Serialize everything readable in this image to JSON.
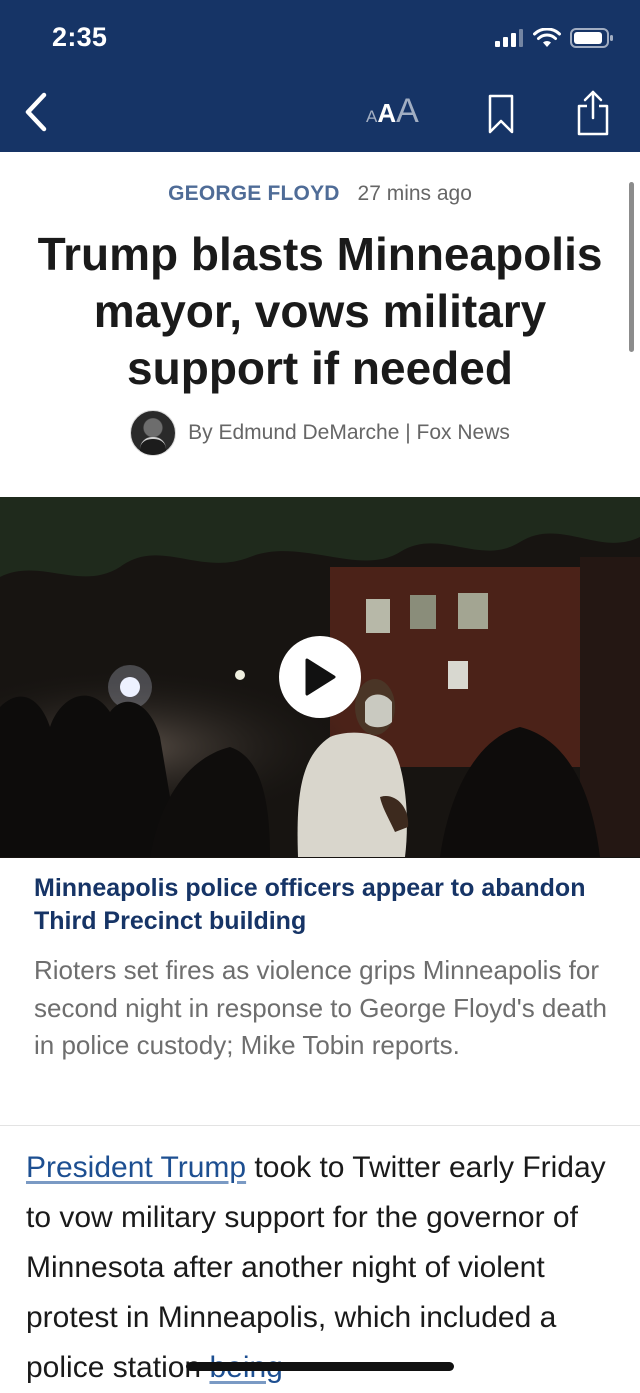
{
  "status_bar": {
    "time": "2:35"
  },
  "toolbar": {
    "font_size_small": "A",
    "font_size_medium": "A",
    "font_size_large": "A"
  },
  "article": {
    "category": "GEORGE FLOYD",
    "time_ago": "27 mins ago",
    "headline": "Trump blasts Minneapolis mayor, vows military support if needed",
    "byline": "By Edmund DeMarche | Fox News"
  },
  "video": {
    "title": "Minneapolis police officers appear to abandon Third Precinct building",
    "description": "Rioters set fires as violence grips Minneapolis for second night in response to George Floyd's death in police custody; Mike Tobin reports."
  },
  "body": {
    "link_text": "President Trump",
    "text_part1": " took to Twitter early Friday to vow military support for the governor of Minnesota after another night of violent protest in Minneapolis, which included a police station ",
    "link_text_2": "being"
  },
  "colors": {
    "header_bg": "#163466",
    "category": "#4f6c97",
    "video_title": "#163466",
    "link": "#1d4f91"
  },
  "icons": {
    "back": "chevron-left-icon",
    "bookmark": "bookmark-icon",
    "share": "share-icon",
    "play": "play-icon"
  }
}
